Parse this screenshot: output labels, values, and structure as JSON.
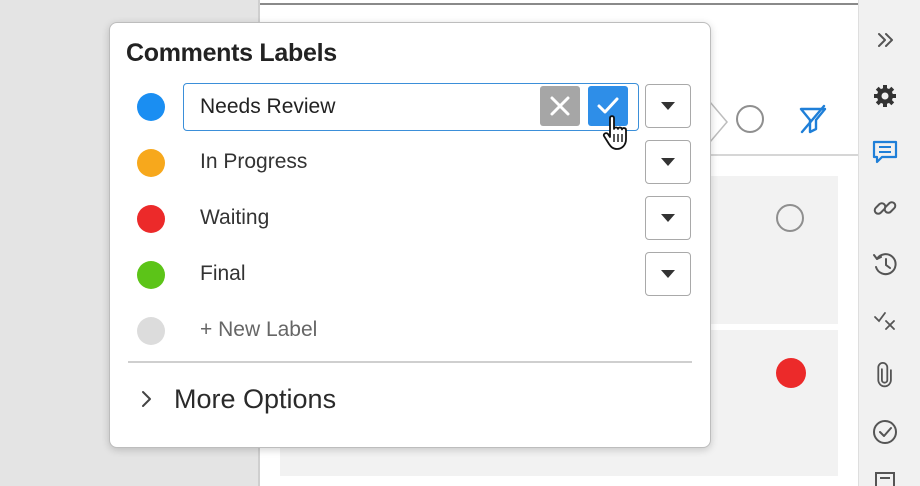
{
  "popover": {
    "title": "Comments Labels",
    "edit_value": "Needs Review",
    "labels": [
      {
        "name": "Needs Review",
        "color": "#1a8ef2",
        "editing": true
      },
      {
        "name": "In Progress",
        "color": "#f7a81c"
      },
      {
        "name": "Waiting",
        "color": "#ec2a2a"
      },
      {
        "name": "Final",
        "color": "#5cc418"
      }
    ],
    "new_label": {
      "text": "+ New Label",
      "color": "#dcdcdc"
    },
    "more_options": "More Options"
  },
  "colors": {
    "accent": "#2e8ee8",
    "cancel_gray": "#a6a6a6",
    "card_bg": "#f2f2f2",
    "red_dot": "#ec2a2a"
  },
  "rail_icons": [
    "double-chevron-right-icon",
    "gear-icon",
    "comment-icon",
    "link-icon",
    "history-icon",
    "check-x-icon",
    "paperclip-icon",
    "check-circle-icon",
    "document-icon"
  ]
}
